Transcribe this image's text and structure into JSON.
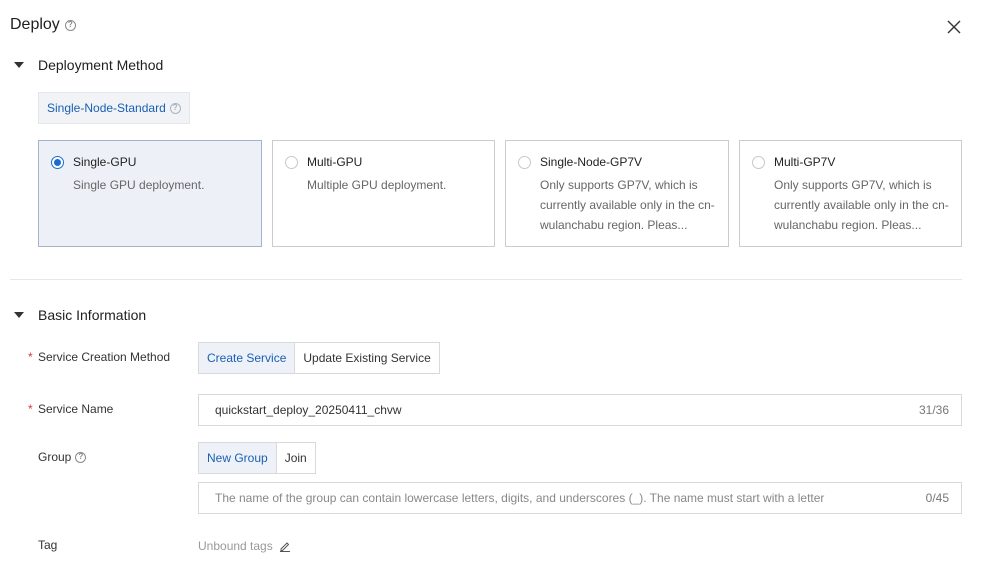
{
  "header": {
    "title": "Deploy",
    "close_icon": "close-icon"
  },
  "deployment_method": {
    "heading": "Deployment Method",
    "standard_tab": "Single-Node-Standard",
    "options": [
      {
        "title": "Single-GPU",
        "description": "Single GPU deployment.",
        "selected": true
      },
      {
        "title": "Multi-GPU",
        "description": "Multiple GPU deployment.",
        "selected": false
      },
      {
        "title": "Single-Node-GP7V",
        "description": "Only supports GP7V, which is currently available only in the cn-wulanchabu region. Pleas...",
        "selected": false
      },
      {
        "title": "Multi-GP7V",
        "description": "Only supports GP7V, which is currently available only in the cn-wulanchabu region. Pleas...",
        "selected": false
      }
    ]
  },
  "basic_information": {
    "heading": "Basic Information",
    "service_creation_method": {
      "label": "Service Creation Method",
      "required_mark": "*",
      "options": [
        "Create Service",
        "Update Existing Service"
      ],
      "selected": "Create Service"
    },
    "service_name": {
      "label": "Service Name",
      "required_mark": "*",
      "value": "quickstart_deploy_20250411_chvw",
      "count": "31/36"
    },
    "group": {
      "label": "Group",
      "options": [
        "New Group",
        "Join"
      ],
      "selected": "New Group",
      "placeholder": "The name of the group can contain lowercase letters, digits, and underscores (_). The name must start with a letter",
      "count": "0/45"
    },
    "tag": {
      "label": "Tag",
      "value": "Unbound tags"
    }
  },
  "colors": {
    "accent": "#1a6cd1",
    "link": "#1a5fb4",
    "required": "#d9363e",
    "selected_card_bg": "#edf1f7"
  }
}
